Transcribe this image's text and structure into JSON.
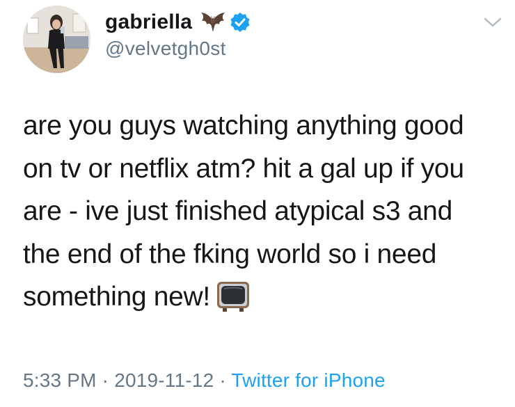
{
  "tweet": {
    "author": {
      "display_name": "gabriella",
      "handle": "@velvetgh0st",
      "name_emoji_icon": "bat-icon",
      "verified_icon": "verified-badge-icon",
      "verified_color": "#1da1f2"
    },
    "menu_icon": "chevron-down-icon",
    "text_lines": [
      "are you guys watching anything good",
      "on tv or netflix atm? hit a gal up if you",
      "are - ive just finished atypical s3 and",
      "the end of the fking world so i need",
      "something new!"
    ],
    "text_emoji_icon": "television-icon",
    "time": "5:33 PM",
    "separator": "·",
    "date": "2019-11-12",
    "source": "Twitter for iPhone",
    "colors": {
      "text": "#14171a",
      "secondary": "#657786",
      "link": "#1da1f2"
    }
  }
}
